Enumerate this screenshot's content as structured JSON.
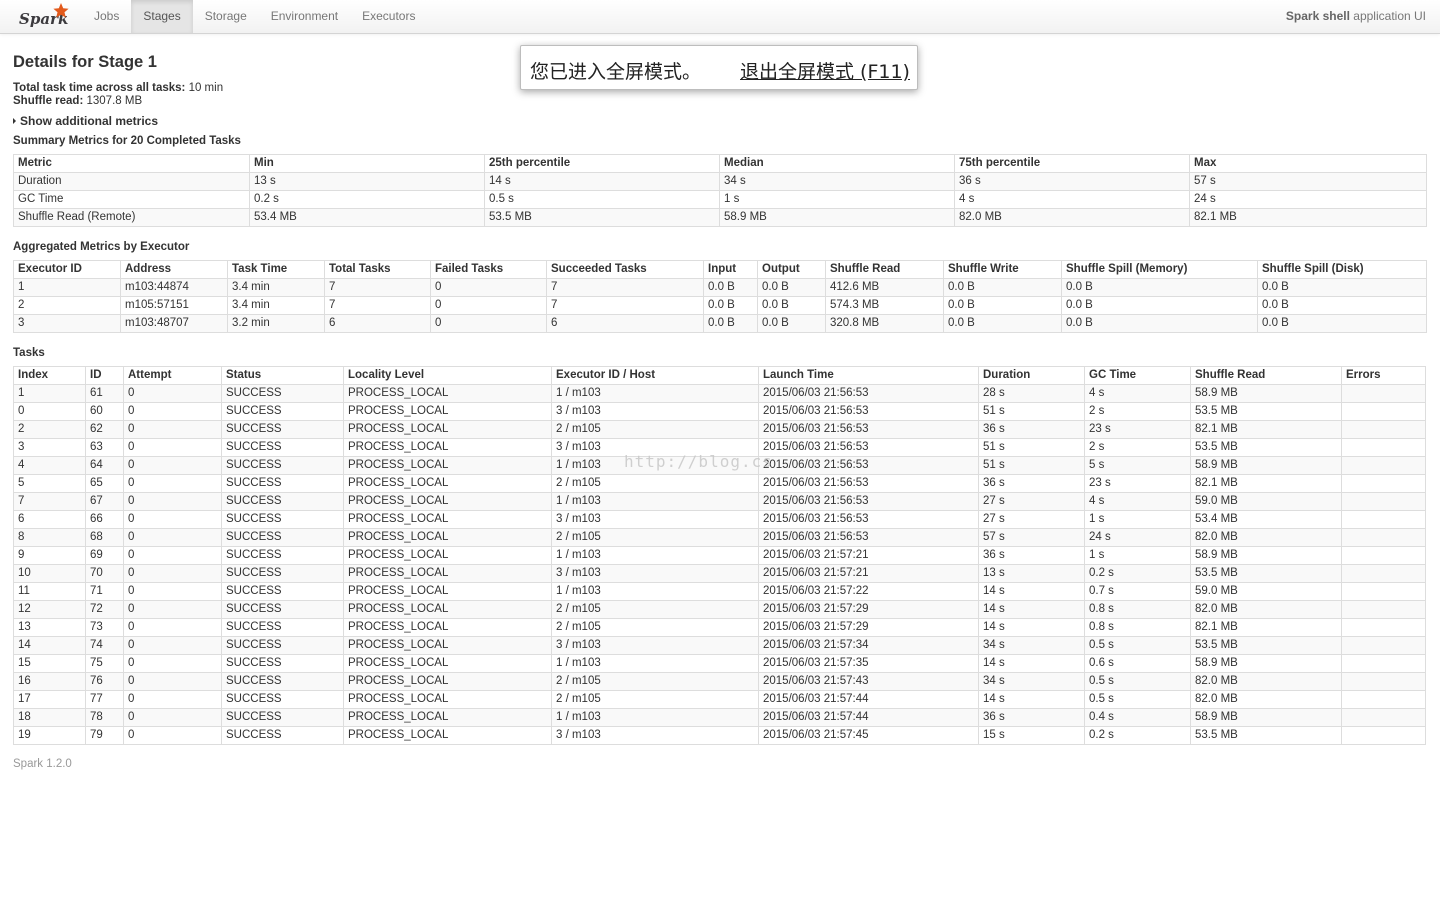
{
  "navbar": {
    "brand": "Spark",
    "tabs": [
      {
        "label": "Jobs",
        "active": false
      },
      {
        "label": "Stages",
        "active": true
      },
      {
        "label": "Storage",
        "active": false
      },
      {
        "label": "Environment",
        "active": false
      },
      {
        "label": "Executors",
        "active": false
      }
    ],
    "app_name": "Spark shell",
    "app_suffix": " application UI"
  },
  "stage": {
    "title": "Details for Stage 1",
    "total_time_label": "Total task time across all tasks:",
    "total_time_value": " 10 min",
    "shuffle_read_label": "Shuffle read:",
    "shuffle_read_value": " 1307.8 MB",
    "toggle_label": "Show additional metrics"
  },
  "summary": {
    "title": "Summary Metrics for 20 Completed Tasks",
    "headers": [
      "Metric",
      "Min",
      "25th percentile",
      "Median",
      "75th percentile",
      "Max"
    ],
    "rows": [
      [
        "Duration",
        "13 s",
        "14 s",
        "34 s",
        "36 s",
        "57 s"
      ],
      [
        "GC Time",
        "0.2 s",
        "0.5 s",
        "1 s",
        "4 s",
        "24 s"
      ],
      [
        "Shuffle Read (Remote)",
        "53.4 MB",
        "53.5 MB",
        "58.9 MB",
        "82.0 MB",
        "82.1 MB"
      ]
    ]
  },
  "executors": {
    "title": "Aggregated Metrics by Executor",
    "headers": [
      "Executor ID",
      "Address",
      "Task Time",
      "Total Tasks",
      "Failed Tasks",
      "Succeeded Tasks",
      "Input",
      "Output",
      "Shuffle Read",
      "Shuffle Write",
      "Shuffle Spill (Memory)",
      "Shuffle Spill (Disk)"
    ],
    "rows": [
      [
        "1",
        "m103:44874",
        "3.4 min",
        "7",
        "0",
        "7",
        "0.0 B",
        "0.0 B",
        "412.6 MB",
        "0.0 B",
        "0.0 B",
        "0.0 B"
      ],
      [
        "2",
        "m105:57151",
        "3.4 min",
        "7",
        "0",
        "7",
        "0.0 B",
        "0.0 B",
        "574.3 MB",
        "0.0 B",
        "0.0 B",
        "0.0 B"
      ],
      [
        "3",
        "m103:48707",
        "3.2 min",
        "6",
        "0",
        "6",
        "0.0 B",
        "0.0 B",
        "320.8 MB",
        "0.0 B",
        "0.0 B",
        "0.0 B"
      ]
    ]
  },
  "tasks": {
    "title": "Tasks",
    "headers": [
      "Index",
      "ID",
      "Attempt",
      "Status",
      "Locality Level",
      "Executor ID / Host",
      "Launch Time",
      "Duration",
      "GC Time",
      "Shuffle Read",
      "Errors"
    ],
    "rows": [
      [
        "1",
        "61",
        "0",
        "SUCCESS",
        "PROCESS_LOCAL",
        "1 / m103",
        "2015/06/03 21:56:53",
        "28 s",
        "4 s",
        "58.9 MB",
        ""
      ],
      [
        "0",
        "60",
        "0",
        "SUCCESS",
        "PROCESS_LOCAL",
        "3 / m103",
        "2015/06/03 21:56:53",
        "51 s",
        "2 s",
        "53.5 MB",
        ""
      ],
      [
        "2",
        "62",
        "0",
        "SUCCESS",
        "PROCESS_LOCAL",
        "2 / m105",
        "2015/06/03 21:56:53",
        "36 s",
        "23 s",
        "82.1 MB",
        ""
      ],
      [
        "3",
        "63",
        "0",
        "SUCCESS",
        "PROCESS_LOCAL",
        "3 / m103",
        "2015/06/03 21:56:53",
        "51 s",
        "2 s",
        "53.5 MB",
        ""
      ],
      [
        "4",
        "64",
        "0",
        "SUCCESS",
        "PROCESS_LOCAL",
        "1 / m103",
        "2015/06/03 21:56:53",
        "51 s",
        "5 s",
        "58.9 MB",
        ""
      ],
      [
        "5",
        "65",
        "0",
        "SUCCESS",
        "PROCESS_LOCAL",
        "2 / m105",
        "2015/06/03 21:56:53",
        "36 s",
        "23 s",
        "82.1 MB",
        ""
      ],
      [
        "7",
        "67",
        "0",
        "SUCCESS",
        "PROCESS_LOCAL",
        "1 / m103",
        "2015/06/03 21:56:53",
        "27 s",
        "4 s",
        "59.0 MB",
        ""
      ],
      [
        "6",
        "66",
        "0",
        "SUCCESS",
        "PROCESS_LOCAL",
        "3 / m103",
        "2015/06/03 21:56:53",
        "27 s",
        "1 s",
        "53.4 MB",
        ""
      ],
      [
        "8",
        "68",
        "0",
        "SUCCESS",
        "PROCESS_LOCAL",
        "2 / m105",
        "2015/06/03 21:56:53",
        "57 s",
        "24 s",
        "82.0 MB",
        ""
      ],
      [
        "9",
        "69",
        "0",
        "SUCCESS",
        "PROCESS_LOCAL",
        "1 / m103",
        "2015/06/03 21:57:21",
        "36 s",
        "1 s",
        "58.9 MB",
        ""
      ],
      [
        "10",
        "70",
        "0",
        "SUCCESS",
        "PROCESS_LOCAL",
        "3 / m103",
        "2015/06/03 21:57:21",
        "13 s",
        "0.2 s",
        "53.5 MB",
        ""
      ],
      [
        "11",
        "71",
        "0",
        "SUCCESS",
        "PROCESS_LOCAL",
        "1 / m103",
        "2015/06/03 21:57:22",
        "14 s",
        "0.7 s",
        "59.0 MB",
        ""
      ],
      [
        "12",
        "72",
        "0",
        "SUCCESS",
        "PROCESS_LOCAL",
        "2 / m105",
        "2015/06/03 21:57:29",
        "14 s",
        "0.8 s",
        "82.0 MB",
        ""
      ],
      [
        "13",
        "73",
        "0",
        "SUCCESS",
        "PROCESS_LOCAL",
        "2 / m105",
        "2015/06/03 21:57:29",
        "14 s",
        "0.8 s",
        "82.1 MB",
        ""
      ],
      [
        "14",
        "74",
        "0",
        "SUCCESS",
        "PROCESS_LOCAL",
        "3 / m103",
        "2015/06/03 21:57:34",
        "34 s",
        "0.5 s",
        "53.5 MB",
        ""
      ],
      [
        "15",
        "75",
        "0",
        "SUCCESS",
        "PROCESS_LOCAL",
        "1 / m103",
        "2015/06/03 21:57:35",
        "14 s",
        "0.6 s",
        "58.9 MB",
        ""
      ],
      [
        "16",
        "76",
        "0",
        "SUCCESS",
        "PROCESS_LOCAL",
        "2 / m105",
        "2015/06/03 21:57:43",
        "34 s",
        "0.5 s",
        "82.0 MB",
        ""
      ],
      [
        "17",
        "77",
        "0",
        "SUCCESS",
        "PROCESS_LOCAL",
        "2 / m105",
        "2015/06/03 21:57:44",
        "14 s",
        "0.5 s",
        "82.0 MB",
        ""
      ],
      [
        "18",
        "78",
        "0",
        "SUCCESS",
        "PROCESS_LOCAL",
        "1 / m103",
        "2015/06/03 21:57:44",
        "36 s",
        "0.4 s",
        "58.9 MB",
        ""
      ],
      [
        "19",
        "79",
        "0",
        "SUCCESS",
        "PROCESS_LOCAL",
        "3 / m103",
        "2015/06/03 21:57:45",
        "15 s",
        "0.2 s",
        "53.5 MB",
        ""
      ]
    ]
  },
  "footer": {
    "version": "Spark 1.2.0"
  },
  "fullscreen_notice": {
    "message": "您已进入全屏模式。",
    "exit_label": "退出全屏模式 (F11)"
  },
  "watermark": "http://blog.cs",
  "colors": {
    "spark_orange": "#e25a1c",
    "logo_text": "#3c3a3e",
    "active_tab_bg": "#e5e5e5"
  },
  "icons": {
    "brand_logo": "spark-logo-icon",
    "toggle_caret": "caret-right-icon"
  }
}
